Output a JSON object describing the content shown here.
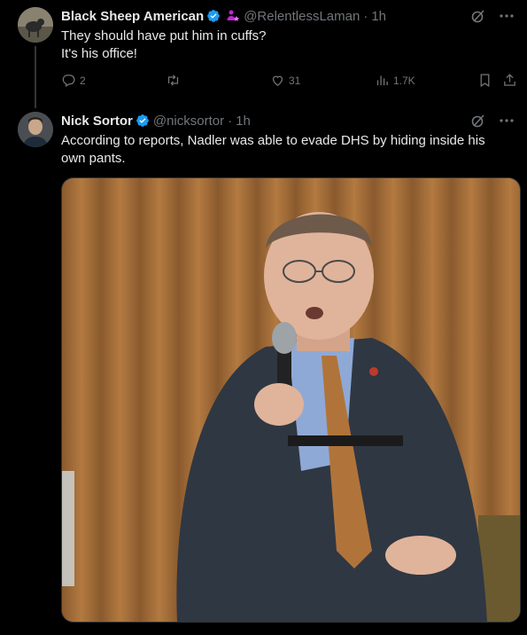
{
  "tweets": [
    {
      "author_name": "Black Sheep American",
      "handle": "@RelentlessLaman",
      "dot": "·",
      "time": "1h",
      "lines": [
        "They should have put him in cuffs?",
        "It's his office!"
      ],
      "stats": {
        "replies": "2",
        "retweets": "",
        "likes": "31",
        "views": "1.7K"
      }
    },
    {
      "author_name": "Nick Sortor",
      "handle": "@nicksortor",
      "dot": "·",
      "time": "1h",
      "text": "According to reports, Nadler was able to evade DHS by hiding inside his own pants."
    }
  ],
  "colors": {
    "background": "#000000",
    "text_primary": "#e7e9ea",
    "text_secondary": "#71767b",
    "verified_blue": "#1d9bf0",
    "affiliate_pink": "#c026d3"
  },
  "icons": {
    "verified": "verified-badge-icon",
    "affiliate": "affiliate-badge-icon",
    "grok": "grok-icon",
    "more": "more-icon",
    "reply": "reply-icon",
    "retweet": "retweet-icon",
    "like": "heart-icon",
    "views": "views-icon",
    "bookmark": "bookmark-icon",
    "share": "share-icon"
  }
}
